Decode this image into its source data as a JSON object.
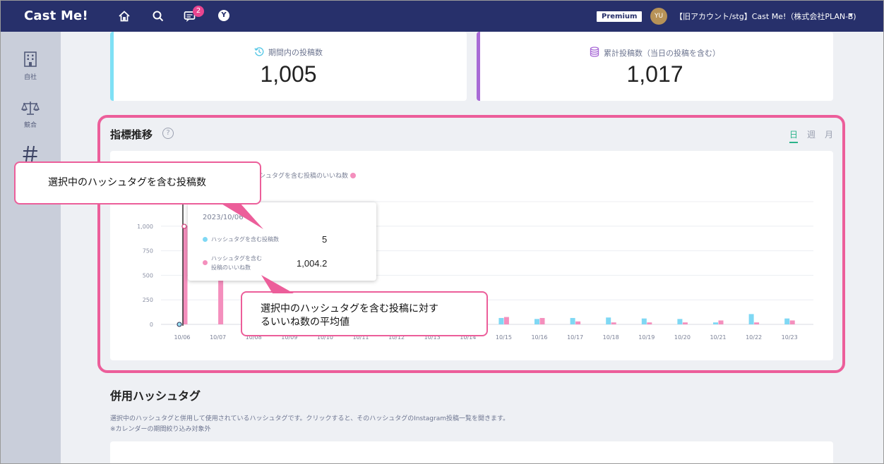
{
  "topbar": {
    "logo": "Cast Me!",
    "notification_count": "2",
    "coin_label": "Y",
    "plan": "Premium",
    "avatar_initials": "YU",
    "account_name": "【旧アカウント/stg】Cast Me!（株式会社PLAN-B)"
  },
  "sidebar": {
    "items": [
      {
        "label": "自社",
        "icon": "building-icon"
      },
      {
        "label": "競合",
        "icon": "scale-icon"
      },
      {
        "label": "",
        "icon": "hashtag-icon"
      }
    ]
  },
  "stats": [
    {
      "label": "期間内の投稿数",
      "value": "1,005",
      "icon": "history-icon",
      "accent": "#7ee0f5"
    },
    {
      "label": "累計投稿数（当日の投稿を含む）",
      "value": "1,017",
      "icon": "database-icon",
      "accent": "#a86ad6"
    }
  ],
  "trend": {
    "title": "指標推移",
    "help": "?",
    "periods": [
      "日",
      "週",
      "月"
    ],
    "active_period": "日",
    "legend_partial": "ハッシュタグを含む投稿のいいね数"
  },
  "chart_data": {
    "type": "bar",
    "categories": [
      "10/06",
      "10/07",
      "10/08",
      "10/09",
      "10/10",
      "10/11",
      "10/12",
      "10/13",
      "10/14",
      "10/15",
      "10/16",
      "10/17",
      "10/18",
      "10/19",
      "10/20",
      "10/21",
      "10/22",
      "10/23"
    ],
    "y_ticks": [
      "0",
      "250",
      "500",
      "750",
      "1,000"
    ],
    "ylim": [
      0,
      1250
    ],
    "series": [
      {
        "name": "ハッシュタグを含む投稿数",
        "color": "#7fd8f4",
        "values": [
          5,
          null,
          null,
          null,
          null,
          null,
          null,
          null,
          55,
          65,
          55,
          65,
          70,
          60,
          55,
          20,
          105,
          60
        ]
      },
      {
        "name": "ハッシュタグを含む投稿のいいね数",
        "color": "#f48fbd",
        "values": [
          1004.2,
          1080,
          null,
          null,
          null,
          null,
          null,
          null,
          60,
          75,
          65,
          30,
          20,
          20,
          20,
          40,
          20,
          40
        ]
      }
    ]
  },
  "tooltip": {
    "date": "2023/10/06",
    "rows": [
      {
        "label": "ハッシュタグを含む投稿数",
        "value": "5"
      },
      {
        "label_line1": "ハッシュタグを含む",
        "label_line2": "投稿のいいね数",
        "value": "1,004.2"
      }
    ]
  },
  "callouts": {
    "top": "選択中のハッシュタグを含む投稿数",
    "bottom_line1": "選択中のハッシュタグを含む投稿に対す",
    "bottom_line2": "るいいね数の平均値"
  },
  "related": {
    "title": "併用ハッシュタグ",
    "description": "選択中のハッシュタグと併用して使用されているハッシュタグです。クリックすると、そのハッシュタグのInstagram投稿一覧を開きます。",
    "note": "※カレンダーの期間絞り込み対象外"
  }
}
